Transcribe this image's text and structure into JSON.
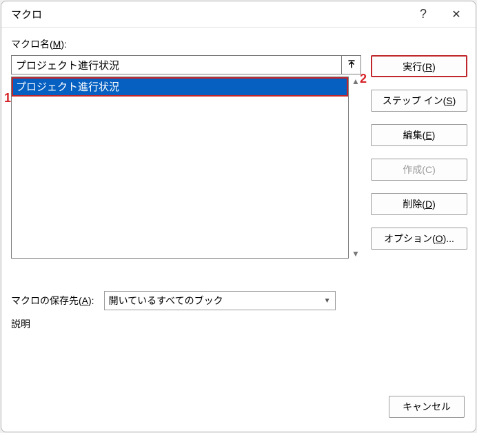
{
  "title": "マクロ",
  "titlebar": {
    "help": "?",
    "close": "✕"
  },
  "labels": {
    "macro_name_pre": "マクロ名(",
    "macro_name_key": "M",
    "macro_name_post": "):",
    "store_pre": "マクロの保存先(",
    "store_key": "A",
    "store_post": "):",
    "description": "説明"
  },
  "macro": {
    "name_value": "プロジェクト進行状況",
    "list_items": [
      "プロジェクト進行状況"
    ]
  },
  "store": {
    "selected": "開いているすべてのブック"
  },
  "buttons": {
    "run_pre": "実行(",
    "run_key": "R",
    "run_post": ")",
    "stepin_pre": "ステップ イン(",
    "stepin_key": "S",
    "stepin_post": ")",
    "edit_pre": "編集(",
    "edit_key": "E",
    "edit_post": ")",
    "create_pre": "作成(",
    "create_key": "C",
    "create_post": ")",
    "delete_pre": "削除(",
    "delete_key": "D",
    "delete_post": ")",
    "options_pre": "オプション(",
    "options_key": "O",
    "options_post": ")...",
    "cancel": "キャンセル"
  },
  "annot": {
    "one": "1",
    "two": "2"
  }
}
